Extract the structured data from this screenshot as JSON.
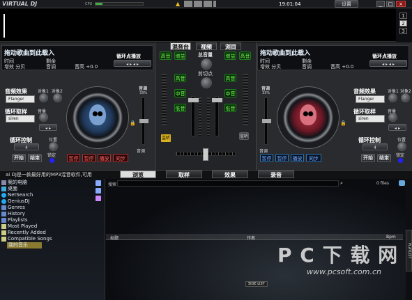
{
  "app": {
    "logo": "VIRTUAL DJ",
    "cpu_label": "CPU",
    "clock": "19:01:04",
    "settings": "设置",
    "skin_pages": [
      "1",
      "2",
      "3"
    ]
  },
  "deck_left": {
    "drag_text": "拖动歌曲到此载入",
    "row1": "时间",
    "row1b": "剩余",
    "row2": "增效 分贝",
    "row2b": "音调",
    "pitch_text": "音高 +0.0",
    "loop_play": "循环点播放",
    "effect": "音频效果",
    "effect_val": "Flanger",
    "sampler": "循环取样",
    "sampler_val": "siren",
    "volume_lbl": "音量",
    "loop_ctrl": "循环控制",
    "loop_val": "4",
    "pos_lbl": "位置",
    "start": "开始",
    "end": "结束",
    "lock": "锁定",
    "pitch_lbl": "音调",
    "pitch_pct": "33%",
    "buttons": [
      "暂停",
      "暂停",
      "播放",
      "同步"
    ],
    "sync_lbl": "对象1",
    "sync_lbl2": "对象2"
  },
  "deck_right": {
    "drag_text": "拖动歌曲到此载入",
    "row1": "时间",
    "row1b": "剩余",
    "row2": "增效 分贝",
    "row2b": "音调",
    "pitch_text": "音高 +0.0",
    "loop_play": "循环点播放",
    "effect": "音频效果",
    "effect_val": "Flanger",
    "sampler": "循环取样",
    "sampler_val": "siren",
    "volume_lbl": "音量",
    "loop_ctrl": "循环控制",
    "loop_val": "4",
    "pos_lbl": "位置",
    "start": "开始",
    "end": "结束",
    "lock": "锁定",
    "pitch_lbl": "音调",
    "pitch_pct": "33%",
    "buttons": [
      "暂停",
      "暂停",
      "播放",
      "同步"
    ],
    "sync_lbl": "对象1",
    "sync_lbl2": "对象2"
  },
  "mixer": {
    "tabs": [
      "混音台",
      "视频",
      "浏目"
    ],
    "gain_lbl": "总音量",
    "cross_lbl": "剪切点",
    "left_btns": [
      "高音",
      "增益",
      "高音",
      "中音",
      "低音"
    ],
    "right_btns": [
      "增益",
      "高音",
      "高音",
      "中音",
      "低音"
    ],
    "left_cue": "监听",
    "right_cue": "监听"
  },
  "status_text": "ai DJ是一款最好用的MP3混音软件,可用",
  "bottom_tabs": [
    "浏览",
    "取样",
    "效果",
    "录音"
  ],
  "browser": {
    "search_label": "搜索",
    "files_count": "0 files",
    "tree": [
      "我的电脑",
      "桌面",
      "NetSearch",
      "GeniusDJ",
      "Genres",
      "History",
      "Playlists",
      "Most Played",
      "Recently Added",
      "Compatible Songs",
      "我的音乐"
    ],
    "col_title": "标题",
    "col_artist": "作者",
    "col_bpm": "Bpm",
    "side_list": "SIDE LIST",
    "playlist_tab": "PLAYLIST"
  },
  "watermark": {
    "big": "P C 下 载 网",
    "url": "www.pcsoft.com.cn"
  }
}
